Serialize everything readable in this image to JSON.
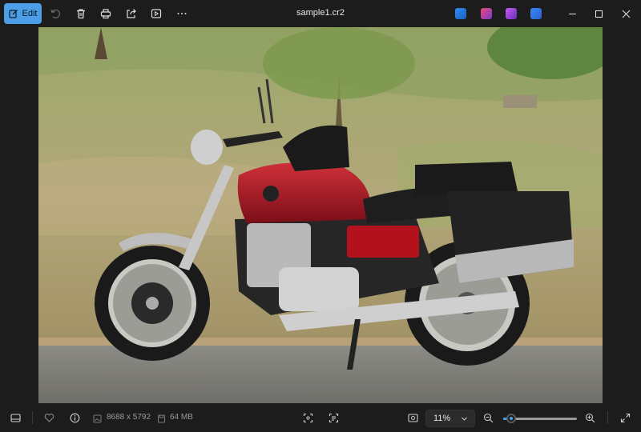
{
  "toolbar": {
    "edit_label": "Edit",
    "icons": [
      "rotate-icon",
      "delete-icon",
      "print-icon",
      "share-icon",
      "slideshow-icon",
      "more-icon"
    ]
  },
  "title": "sample1.cr2",
  "apps": [
    {
      "name": "app-1",
      "color": "#2f8df5"
    },
    {
      "name": "app-2",
      "color": "#e84a7a"
    },
    {
      "name": "app-3",
      "color": "#9a4ee0"
    },
    {
      "name": "app-4",
      "color": "#2b6fd8"
    }
  ],
  "status": {
    "dimensions": "8688 x 5792",
    "size": "64 MB",
    "zoom": "11%",
    "zoom_fraction": 0.05
  },
  "colors": {
    "accent": "#4c9fe6",
    "background": "#1c1c1c"
  }
}
